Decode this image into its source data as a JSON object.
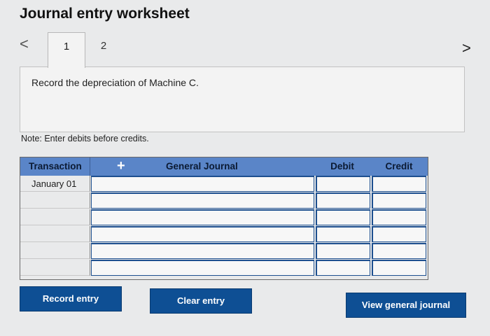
{
  "header": {
    "title": "Journal entry worksheet"
  },
  "nav": {
    "prev": "<",
    "next": ">"
  },
  "tabs": [
    {
      "label": "1"
    },
    {
      "label": "2"
    }
  ],
  "instruction": "Record the depreciation of Machine C.",
  "note": "Note: Enter debits before credits.",
  "journal": {
    "columns": {
      "transaction": "Transaction",
      "add": "+",
      "general_journal": "General Journal",
      "debit": "Debit",
      "credit": "Credit"
    },
    "rows": [
      {
        "transaction": "January 01"
      },
      {
        "transaction": ""
      },
      {
        "transaction": ""
      },
      {
        "transaction": ""
      },
      {
        "transaction": ""
      },
      {
        "transaction": ""
      }
    ]
  },
  "buttons": {
    "record": "Record entry",
    "clear": "Clear entry",
    "view": "View general journal"
  },
  "colors": {
    "header_blue": "#5a85c8",
    "button_blue": "#0e4f94",
    "input_border": "#1d4f8f"
  }
}
